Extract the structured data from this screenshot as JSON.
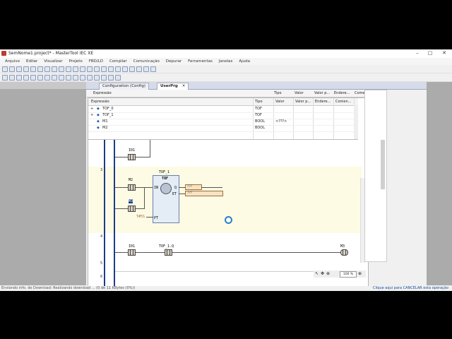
{
  "window": {
    "title": "SemNome1.project* - MasterTool IEC XE"
  },
  "menu": [
    "Arquivo",
    "Editar",
    "Visualizar",
    "Projeto",
    "FBD/LD",
    "Compilar",
    "Comunicação",
    "Depurar",
    "Ferramentas",
    "Janelas",
    "Ajuda"
  ],
  "tabs": [
    {
      "label": "Configuration (Config)",
      "active": false
    },
    {
      "label": "UserPrg",
      "active": true
    }
  ],
  "vars": {
    "header": {
      "expression": "Expressão",
      "type": "Tipo",
      "value": "Valor",
      "prepared": "Valor p...",
      "address": "Endere...",
      "comment": "Comen..."
    },
    "outer_header": {
      "expression": "Expressão",
      "type": "Tipo",
      "value": "Valor",
      "prepared": "Valor p...",
      "address": "Endere...",
      "comment": "Comen..."
    },
    "rows": [
      {
        "expr": "TOF_0",
        "type": "TOF",
        "value": "",
        "expand": "+"
      },
      {
        "expr": "TOF_1",
        "type": "TOF",
        "value": "",
        "expand": "+"
      },
      {
        "expr": "M1",
        "type": "BOOL",
        "value": "<???>",
        "expand": ""
      },
      {
        "expr": "M2",
        "type": "BOOL",
        "value": "",
        "expand": ""
      }
    ]
  },
  "ladder": {
    "rung_numbers": [
      "3",
      "4",
      "5",
      "6"
    ],
    "rung2_top_contact": "I01",
    "rung3": {
      "contact_a": "M2",
      "contact_b": "M3",
      "fb_instance": "TOF_1",
      "fb_type": "TOF",
      "in_pin": "IN",
      "q_pin": "Q",
      "et_pin": "ET",
      "pt_pin": "PT",
      "pt_value": "T#5S",
      "out_q": "???",
      "out_et": "???"
    },
    "rung4": {
      "contact_a": "I01",
      "contact_b": "TOF_1.Q",
      "coil": "M3"
    }
  },
  "zoom": {
    "value": "100 %"
  },
  "status": {
    "left": "Enviando info. de Download: Realizando download ... (0 de 11 KBytes (0%))",
    "right": "Clique aqui para CANCELAR esta operação"
  }
}
